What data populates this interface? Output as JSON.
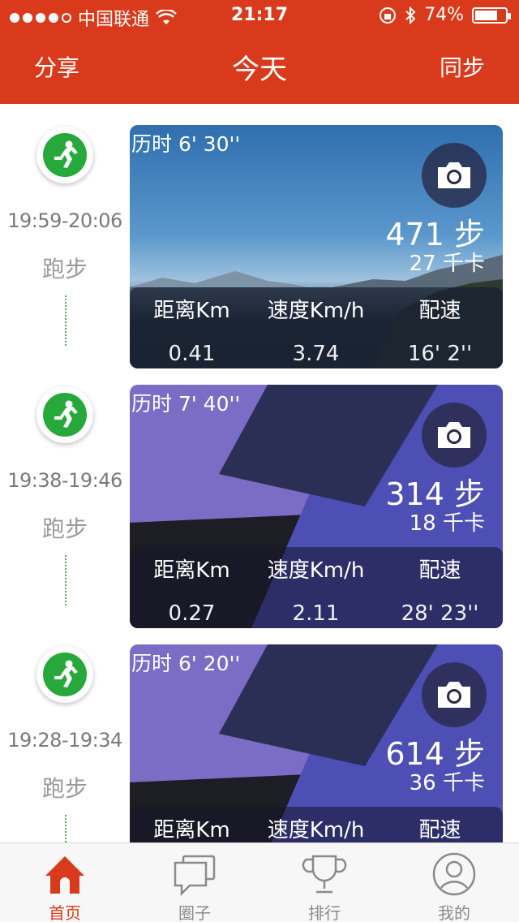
{
  "status_bar": {
    "carrier": "中国联通",
    "time": "21:17",
    "battery": "74%",
    "battery_level": 0.74
  },
  "nav": {
    "left": "分享",
    "title": "今天",
    "right": "同步"
  },
  "activities": [
    {
      "time_range": "19:59-20:06",
      "type": "跑步",
      "duration": "历时 6' 30''",
      "steps": "471 步",
      "kcal": "27 千卡",
      "metric_labels": [
        "距离Km",
        "速度Km/h",
        "配速"
      ],
      "metric_values": [
        "0.41",
        "3.74",
        "16' 2''"
      ]
    },
    {
      "time_range": "19:38-19:46",
      "type": "跑步",
      "duration": "历时 7' 40''",
      "steps": "314 步",
      "kcal": "18 千卡",
      "metric_labels": [
        "距离Km",
        "速度Km/h",
        "配速"
      ],
      "metric_values": [
        "0.27",
        "2.11",
        "28' 23''"
      ]
    },
    {
      "time_range": "19:28-19:34",
      "type": "跑步",
      "duration": "历时 6' 20''",
      "steps": "614 步",
      "kcal": "36 千卡",
      "metric_labels": [
        "距离Km",
        "速度Km/h",
        "配速"
      ],
      "metric_values": [
        "",
        "",
        ""
      ]
    }
  ],
  "tabs": [
    {
      "label": "首页",
      "icon": "home-icon",
      "active": true
    },
    {
      "label": "圈子",
      "icon": "chat-icon",
      "active": false
    },
    {
      "label": "排行",
      "icon": "trophy-icon",
      "active": false
    },
    {
      "label": "我的",
      "icon": "user-icon",
      "active": false
    }
  ],
  "colors": {
    "accent": "#d93a1b",
    "run_green": "#27a83a"
  }
}
